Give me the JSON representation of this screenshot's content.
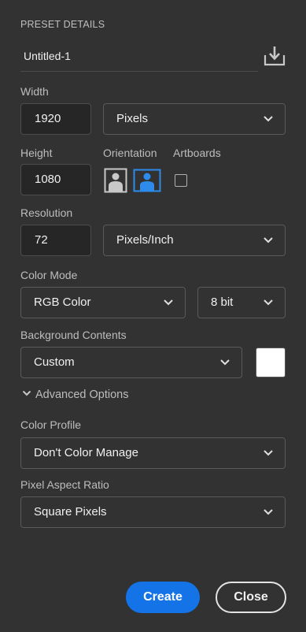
{
  "preset": {
    "section_title": "PRESET DETAILS",
    "name": "Untitled-1",
    "save_icon": "save-preset-icon"
  },
  "width": {
    "label": "Width",
    "value": "1920",
    "unit": "Pixels"
  },
  "height": {
    "label": "Height",
    "value": "1080"
  },
  "orientation": {
    "label": "Orientation",
    "selected": "landscape",
    "accent_color": "#2d8ceb"
  },
  "artboards": {
    "label": "Artboards",
    "checked": false
  },
  "resolution": {
    "label": "Resolution",
    "value": "72",
    "unit": "Pixels/Inch"
  },
  "color_mode": {
    "label": "Color Mode",
    "mode": "RGB Color",
    "depth": "8 bit"
  },
  "background": {
    "label": "Background Contents",
    "value": "Custom",
    "swatch_color": "#ffffff"
  },
  "advanced": {
    "toggle_label": "Advanced Options",
    "expanded": true
  },
  "color_profile": {
    "label": "Color Profile",
    "value": "Don't Color Manage"
  },
  "pixel_aspect": {
    "label": "Pixel Aspect Ratio",
    "value": "Square Pixels"
  },
  "actions": {
    "create_label": "Create",
    "close_label": "Close",
    "primary_color": "#1473e6"
  }
}
